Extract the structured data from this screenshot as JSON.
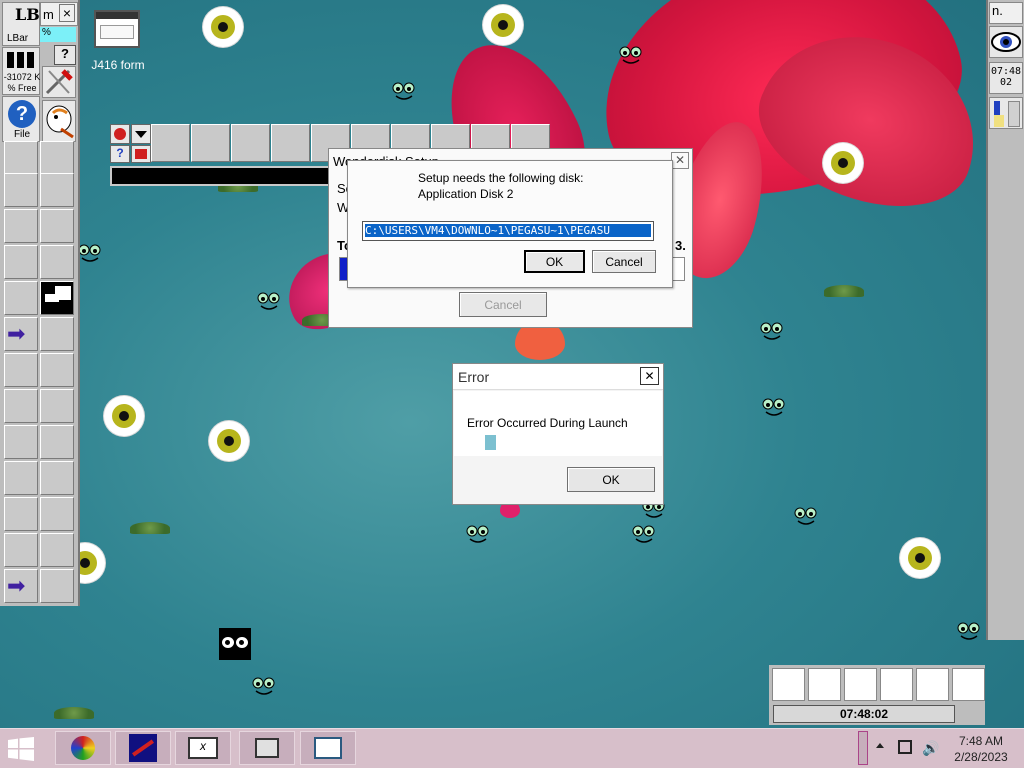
{
  "desktop": {
    "icon_label": "J416 form"
  },
  "left_bar": {
    "app_label": "LBar",
    "memory_text": "-31072 K",
    "free_text": "% Free",
    "file_label": "File",
    "partial_title": "m",
    "partial_pct": "%",
    "close_glyph": "×",
    "help_glyph": "?"
  },
  "right_bar": {
    "partial_title": "n.",
    "clock_top": "07:48",
    "clock_bottom": "02"
  },
  "wonderdisk_window": {
    "title": "Wonderdisk Setup",
    "partial_left_1": "Se",
    "partial_left_2": "W",
    "partial_left_3": "To",
    "partial_right": "3.",
    "cancel_label": "Cancel"
  },
  "disk_dialog": {
    "line1": "Setup needs the following disk:",
    "line2": "Application Disk 2",
    "path_value": "C:\\USERS\\VM4\\DOWNLO~1\\PEGASU~1\\PEGASU",
    "ok_label": "OK",
    "cancel_label": "Cancel"
  },
  "error_dialog": {
    "title": "Error",
    "message": "Error Occurred During Launch",
    "ok_label": "OK",
    "close_glyph": "✕"
  },
  "clock_widget": {
    "time": "07:48:02"
  },
  "taskbar": {
    "time": "7:48 AM",
    "date": "2/28/2023"
  },
  "colors": {
    "taskbar_bg": "#d7bfca",
    "selection": "#0a64c8",
    "progress": "#1020c8"
  }
}
